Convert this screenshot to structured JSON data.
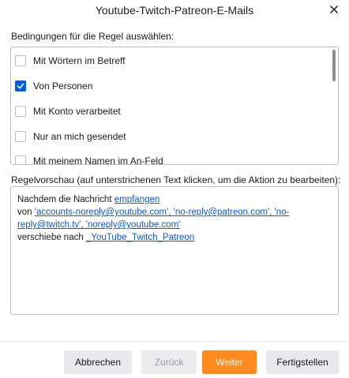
{
  "window": {
    "title": "Youtube-Twitch-Patreon-E-Mails",
    "close_icon": "close-icon"
  },
  "conditions": {
    "label": "Bedingungen für die Regel auswählen:",
    "items": [
      {
        "label": "Mit Wörtern im Betreff",
        "checked": false
      },
      {
        "label": "Von Personen",
        "checked": true
      },
      {
        "label": "Mit Konto verarbeitet",
        "checked": false
      },
      {
        "label": "Nur an mich gesendet",
        "checked": false
      },
      {
        "label": "Mit meinem Namen im An-Feld",
        "checked": false
      }
    ]
  },
  "preview": {
    "label": "Regelvorschau (auf unterstrichenen Text klicken, um die Aktion zu bearbeiten):",
    "line1_prefix": "Nachdem die Nachricht ",
    "line1_link": "empfangen",
    "line2_prefix": "von ",
    "senders_link_part1": "'accounts-noreply@youtube.com', 'no-reply@patreon.com', 'no-",
    "senders_link_part2": "reply@twitch.tv', 'noreply@youtube.com'",
    "line4_prefix": "verschiebe nach ",
    "folder_link": "_YouTube_Twitch_Patreon"
  },
  "buttons": {
    "cancel": "Abbrechen",
    "back": "Zurück",
    "next": "Weiter",
    "finish": "Fertigstellen"
  },
  "colors": {
    "accent": "#0061e0",
    "primary_button": "#ff8a1f",
    "link": "#0b57d0"
  }
}
